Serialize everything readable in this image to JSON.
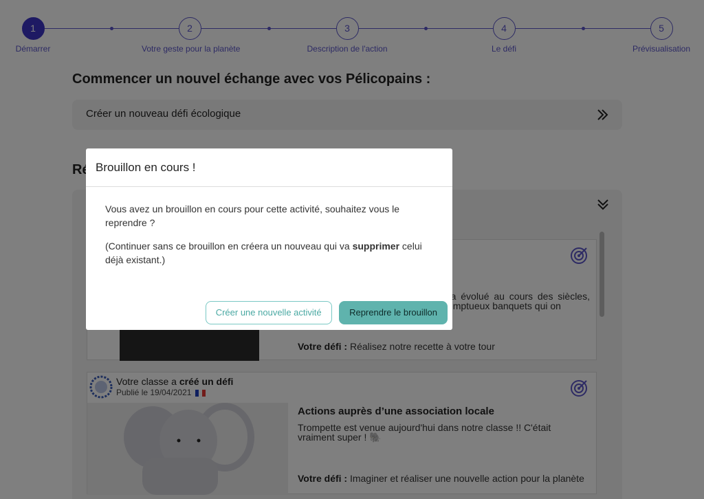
{
  "stepper": {
    "steps": [
      {
        "num": "1",
        "label": "Démarrer"
      },
      {
        "num": "2",
        "label": "Votre geste pour la planète"
      },
      {
        "num": "3",
        "label": "Description de l'action"
      },
      {
        "num": "4",
        "label": "Le défi"
      },
      {
        "num": "5",
        "label": "Prévisualisation"
      }
    ]
  },
  "main": {
    "title": "Commencer un nouvel échange avec vos Pélicopains :",
    "new_exchange_label": "Créer un nouveau défi écologique",
    "section_title_2_visible": "Ré",
    "card1": {
      "text": "à divers styles gastronomiques e a évolué au cours des siècles, ciaux et politiques du pays. Le de somptueux banquets qui on",
      "defi_label": "Votre défi :",
      "defi_value": " Réalisez notre recette à votre tour"
    },
    "card2": {
      "author_prefix": "Votre classe a ",
      "author_action": "créé un défi",
      "published": "Publié le 19/04/2021",
      "title": "Actions auprès d’une association locale",
      "text": "Trompette est venue aujourd'hui dans notre classe !! C'était vraiment super ! 🐘",
      "defi_label": "Votre défi :",
      "defi_value": " Imaginer et réaliser une nouvelle action pour la planète"
    }
  },
  "modal": {
    "title": "Brouillon en cours !",
    "para1": "Vous avez un brouillon en cours pour cette activité, souhaitez vous le reprendre ?",
    "para2_before": "(Continuer sans ce brouillon en créera un nouveau qui va ",
    "para2_bold": "supprimer",
    "para2_after": " celui déjà existant.)",
    "btn_new": "Créer une nouvelle activité",
    "btn_resume": "Reprendre le brouillon"
  },
  "colors": {
    "accent": "#5a55c8",
    "accent_active": "#3d35c6",
    "teal": "#5fb3ad"
  }
}
